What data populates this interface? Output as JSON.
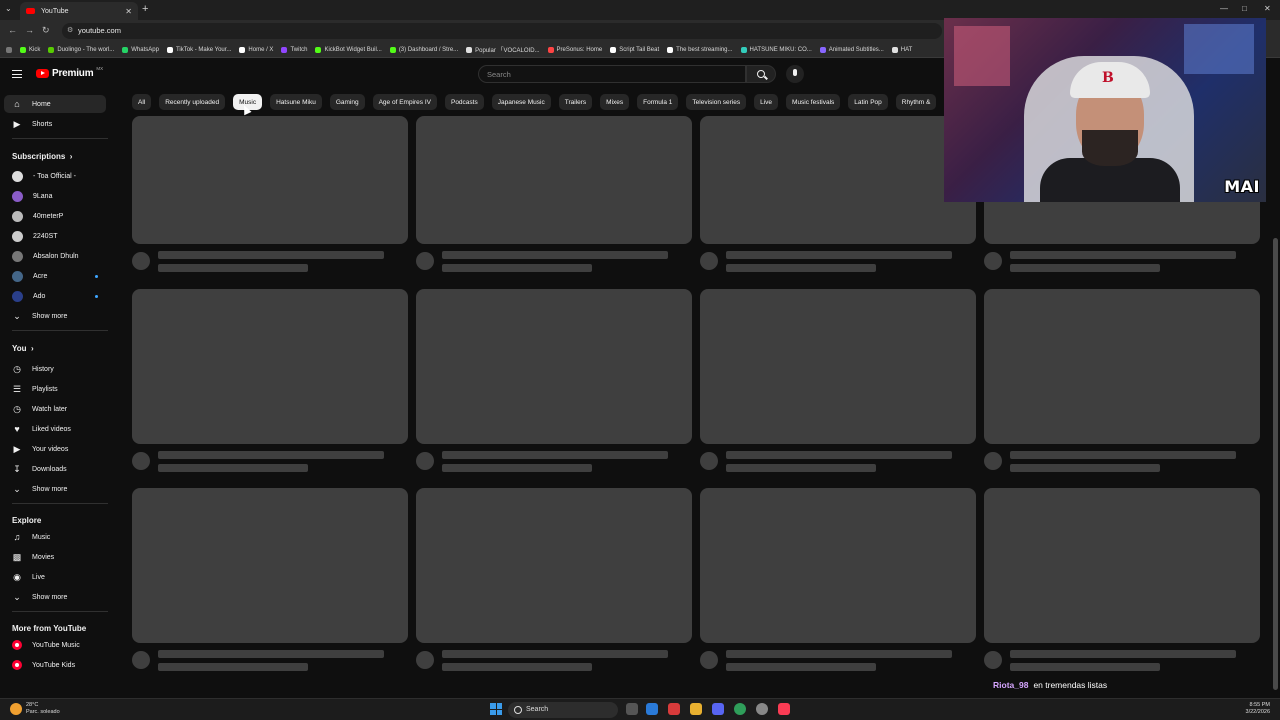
{
  "browser": {
    "tab_title": "YouTube",
    "url": "youtube.com",
    "bookmarks": [
      {
        "label": "Kick",
        "color": "#53fc18"
      },
      {
        "label": "Duolingo - The worl...",
        "color": "#58cc02"
      },
      {
        "label": "WhatsApp",
        "color": "#25d366"
      },
      {
        "label": "TikTok - Make Your...",
        "color": "#ffffff"
      },
      {
        "label": "Home / X",
        "color": "#ffffff"
      },
      {
        "label": "Twitch",
        "color": "#9146ff"
      },
      {
        "label": "KickBot Widget Buil...",
        "color": "#53fc18"
      },
      {
        "label": "(3) Dashboard / Stre...",
        "color": "#53fc18"
      },
      {
        "label": "Popular 「VOCALOID...",
        "color": "#e0e0e0"
      },
      {
        "label": "PreSonus: Home",
        "color": "#ff4444"
      },
      {
        "label": "Script Tail Beat",
        "color": "#ffffff"
      },
      {
        "label": "The best streaming...",
        "color": "#ffffff"
      },
      {
        "label": "HATSUNE MIKU: CO...",
        "color": "#33ccbb"
      },
      {
        "label": "Animated Subtitles...",
        "color": "#8866ff"
      },
      {
        "label": "HAT",
        "color": "#e0e0e0"
      }
    ]
  },
  "header": {
    "logo_word": "Premium",
    "region": "MX",
    "search_placeholder": "Search"
  },
  "chips": [
    "All",
    "Recently uploaded",
    "Music",
    "Hatsune Miku",
    "Gaming",
    "Age of Empires IV",
    "Podcasts",
    "Japanese Music",
    "Trailers",
    "Mixes",
    "Formula 1",
    "Television series",
    "Live",
    "Music festivals",
    "Latin Pop",
    "Rhythm &"
  ],
  "active_chip": "Music",
  "sidebar": {
    "home": "Home",
    "shorts": "Shorts",
    "subscriptions_heading": "Subscriptions",
    "subscriptions": [
      {
        "label": "- Toa Official -",
        "color": "#dddddd",
        "dot": false
      },
      {
        "label": "9Lana",
        "color": "#8a5cc7",
        "dot": false
      },
      {
        "label": "40meterP",
        "color": "#bbbbbb",
        "dot": false
      },
      {
        "label": "2240ST",
        "color": "#cccccc",
        "dot": false
      },
      {
        "label": "Absalon Dhuln",
        "color": "#777777",
        "dot": false
      },
      {
        "label": "Acre",
        "color": "#446688",
        "dot": true
      },
      {
        "label": "Ado",
        "color": "#2a3f8a",
        "dot": true
      }
    ],
    "show_more": "Show more",
    "you_heading": "You",
    "you_items": [
      "History",
      "Playlists",
      "Watch later",
      "Liked videos",
      "Your videos",
      "Downloads"
    ],
    "explore_heading": "Explore",
    "explore_items": [
      "Music",
      "Movies",
      "Live"
    ],
    "more_heading": "More from YouTube",
    "more_items": [
      "YouTube Music",
      "YouTube Kids"
    ]
  },
  "overlay": {
    "cam_tag": "MAI",
    "chat_user": "Riota_98",
    "chat_message": "en tremendas listas"
  },
  "taskbar": {
    "temp": "28°C",
    "weather": "Parc. soleado",
    "search": "Search",
    "time": "8:55 PM",
    "date": "3/22/2026"
  }
}
